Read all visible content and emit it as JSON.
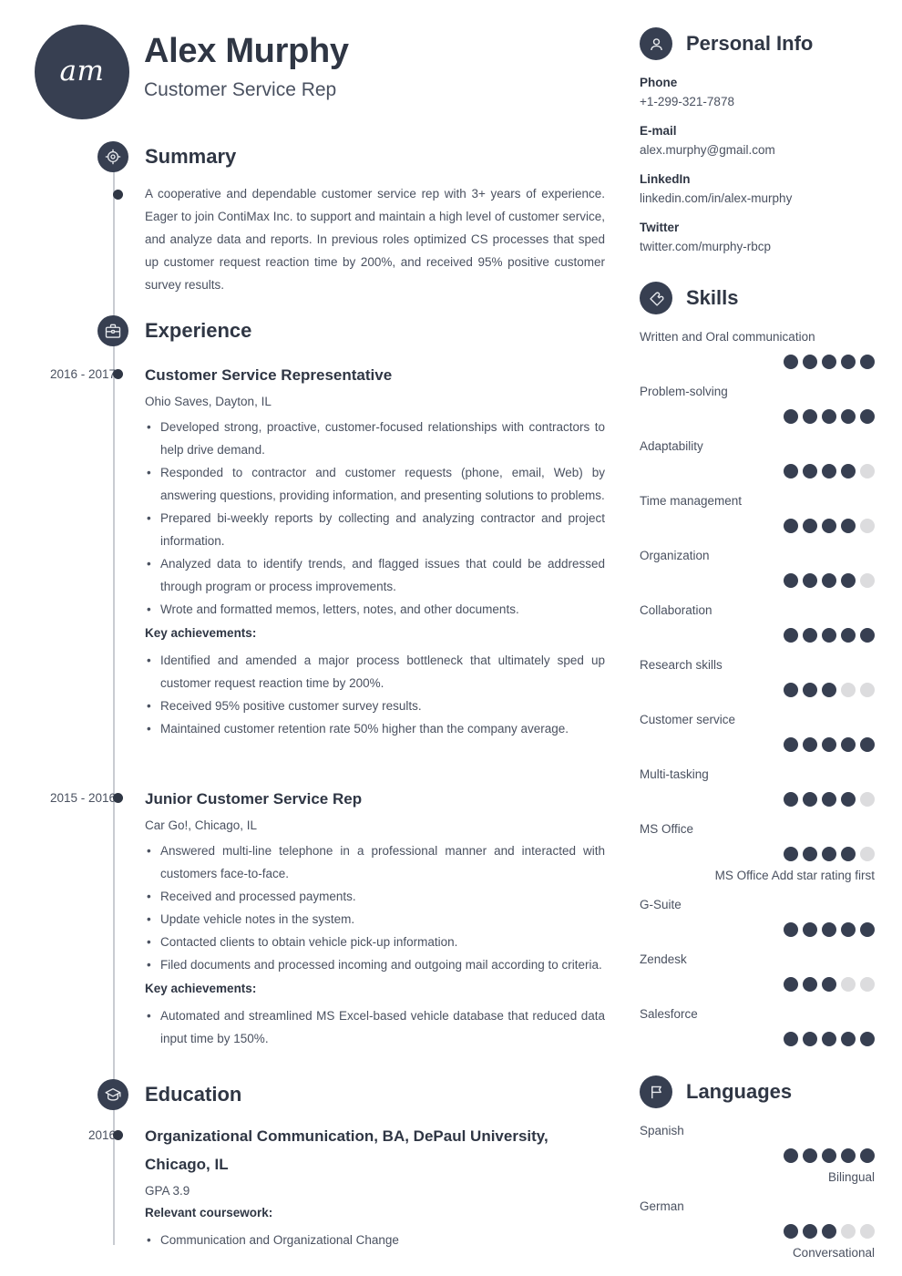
{
  "header": {
    "initials": "am",
    "name": "Alex Murphy",
    "job_title": "Customer Service Rep"
  },
  "summary": {
    "title": "Summary",
    "icon": "target-icon",
    "text": "A cooperative and dependable customer service rep with 3+ years of experience. Eager to join ContiMax Inc. to support and maintain a high level of customer service, and analyze data and reports. In previous roles optimized CS processes that sped up customer request reaction time by 200%, and received 95% positive customer survey results."
  },
  "experience": {
    "title": "Experience",
    "icon": "briefcase-icon",
    "key_achievements_label": "Key achievements:",
    "jobs": [
      {
        "date": "2016 - 2017",
        "title": "Customer Service Representative",
        "company": "Ohio Saves, Dayton, IL",
        "bullets": [
          "Developed strong, proactive, customer-focused relationships with contractors to help drive demand.",
          "Responded to contractor and customer requests (phone, email, Web) by answering questions, providing information, and presenting solutions to problems.",
          "Prepared bi-weekly reports by collecting and analyzing contractor and project information.",
          "Analyzed data to identify trends, and flagged issues that could be addressed through program or process improvements.",
          "Wrote and formatted memos, letters, notes, and other documents."
        ],
        "achievements": [
          "Identified and amended a major process bottleneck that ultimately sped up customer request reaction time by 200%.",
          "Received 95% positive customer survey results.",
          "Maintained customer retention rate 50% higher than the company average."
        ]
      },
      {
        "date": "2015 - 2016",
        "title": "Junior Customer Service Rep",
        "company": "Car Go!, Chicago, IL",
        "bullets": [
          "Answered multi-line telephone in a professional manner and interacted with customers face-to-face.",
          "Received and processed payments.",
          "Update vehicle notes in the system.",
          "Contacted clients to obtain vehicle pick-up information.",
          "Filed documents and processed incoming and outgoing mail according to criteria."
        ],
        "achievements": [
          "Automated and streamlined MS Excel-based vehicle database that reduced data input time by 150%."
        ]
      }
    ]
  },
  "education": {
    "title": "Education",
    "icon": "graduation-cap-icon",
    "entries": [
      {
        "date": "2016",
        "title": "Organizational Communication, BA, DePaul University, Chicago, IL",
        "gpa": "GPA 3.9",
        "coursework_label": "Relevant coursework:",
        "coursework": [
          "Communication and Organizational Change"
        ]
      }
    ]
  },
  "personal_info": {
    "title": "Personal Info",
    "icon": "person-icon",
    "fields": [
      {
        "label": "Phone",
        "value": "+1-299-321-7878"
      },
      {
        "label": "E-mail",
        "value": "alex.murphy@gmail.com"
      },
      {
        "label": "LinkedIn",
        "value": "linkedin.com/in/alex-murphy"
      },
      {
        "label": "Twitter",
        "value": "twitter.com/murphy-rbcp"
      }
    ]
  },
  "skills": {
    "title": "Skills",
    "icon": "puzzle-icon",
    "max_rating": 5,
    "items": [
      {
        "label": "Written and Oral communication",
        "rating": 5,
        "note": ""
      },
      {
        "label": "Problem-solving",
        "rating": 5,
        "note": ""
      },
      {
        "label": "Adaptability",
        "rating": 4,
        "note": ""
      },
      {
        "label": "Time management",
        "rating": 4,
        "note": ""
      },
      {
        "label": "Organization",
        "rating": 4,
        "note": ""
      },
      {
        "label": "Collaboration",
        "rating": 5,
        "note": ""
      },
      {
        "label": "Research skills",
        "rating": 3,
        "note": ""
      },
      {
        "label": "Customer service",
        "rating": 5,
        "note": ""
      },
      {
        "label": "Multi-tasking",
        "rating": 4,
        "note": ""
      },
      {
        "label": "MS Office",
        "rating": 4,
        "note": "MS Office Add star rating first"
      },
      {
        "label": "G-Suite",
        "rating": 5,
        "note": ""
      },
      {
        "label": "Zendesk",
        "rating": 3,
        "note": ""
      },
      {
        "label": "Salesforce",
        "rating": 5,
        "note": ""
      }
    ]
  },
  "languages": {
    "title": "Languages",
    "icon": "flag-icon",
    "max_rating": 5,
    "items": [
      {
        "label": "Spanish",
        "rating": 5,
        "note": "Bilingual"
      },
      {
        "label": "German",
        "rating": 3,
        "note": "Conversational"
      }
    ]
  },
  "colors": {
    "accent": "#373f51",
    "heading": "#2f3644",
    "body": "#4a5160",
    "empty_dot": "#dcdcde",
    "rule": "#c9ccd2"
  }
}
